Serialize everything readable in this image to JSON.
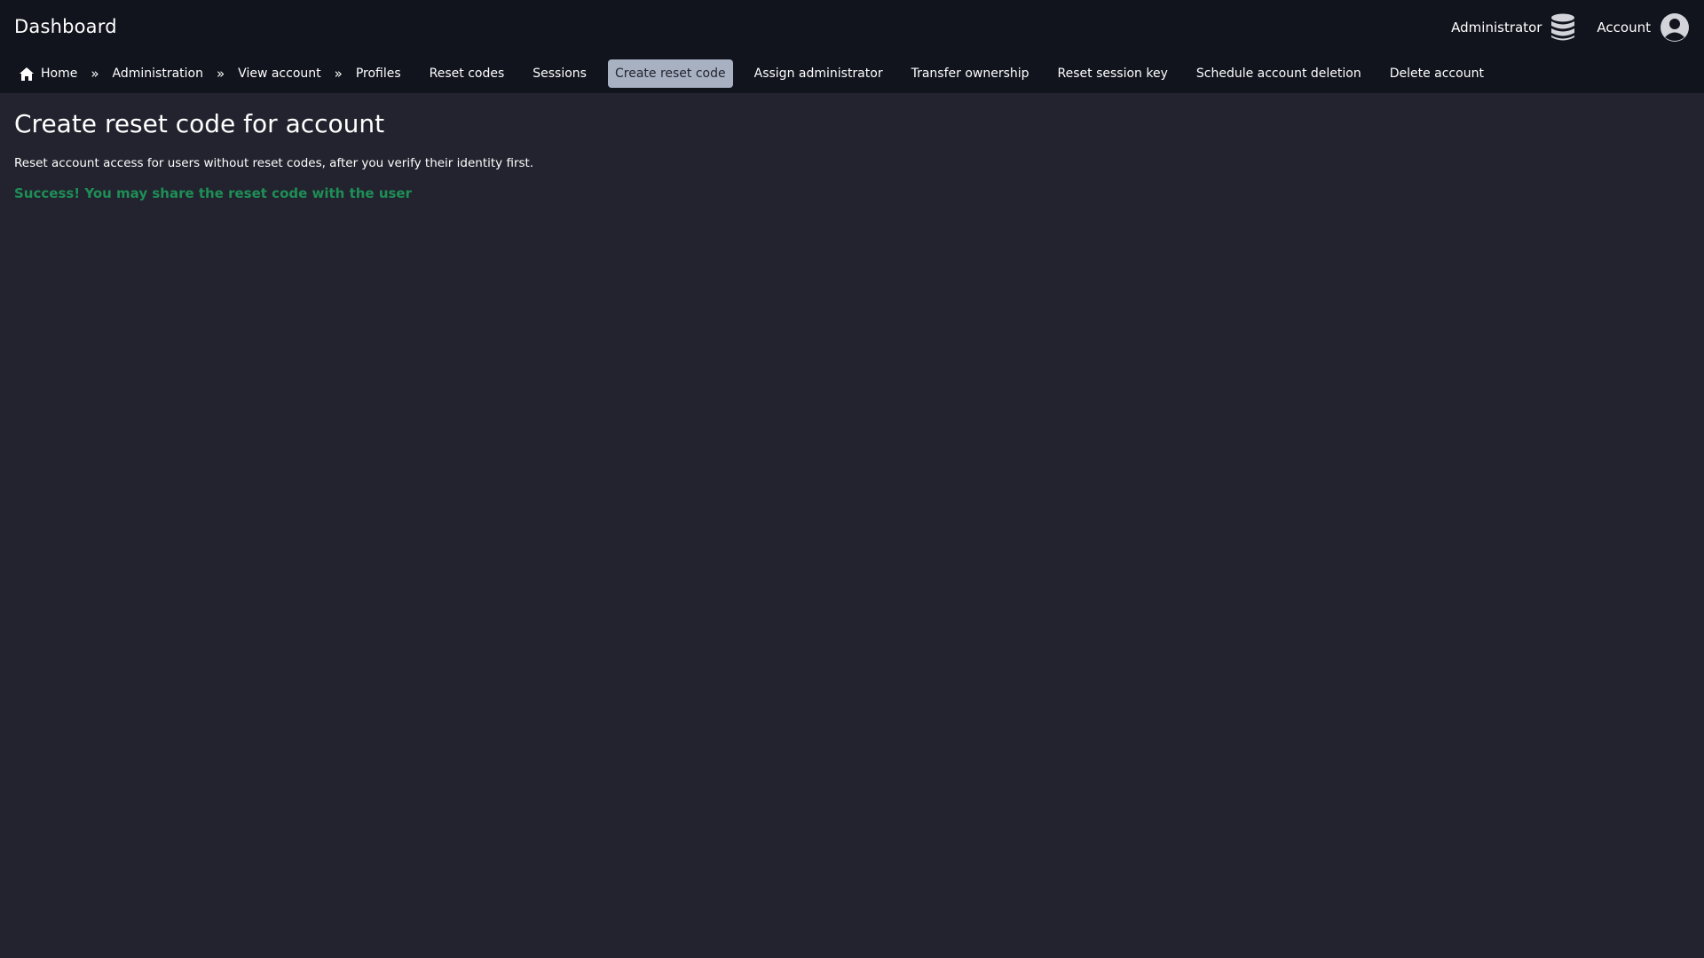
{
  "header": {
    "title": "Dashboard",
    "admin_label": "Administrator",
    "admin_icon": "database-icon",
    "account_label": "Account",
    "account_icon": "user-circle-icon"
  },
  "breadcrumbs": [
    {
      "label": "Home",
      "icon": "home-icon"
    },
    {
      "label": "Administration"
    },
    {
      "label": "View account"
    },
    {
      "label": "Profiles"
    }
  ],
  "breadcrumb_separator": "»",
  "actions": [
    {
      "label": "Reset codes",
      "active": false
    },
    {
      "label": "Sessions",
      "active": false
    },
    {
      "label": "Create reset code",
      "active": true
    },
    {
      "label": "Assign administrator",
      "active": false
    },
    {
      "label": "Transfer ownership",
      "active": false
    },
    {
      "label": "Reset session key",
      "active": false
    },
    {
      "label": "Schedule account deletion",
      "active": false
    },
    {
      "label": "Delete account",
      "active": false
    }
  ],
  "main": {
    "title": "Create reset code for account",
    "description": "Reset account access for users without reset codes, after you verify their identity first.",
    "success_message": "Success! You may share the reset code with the user"
  },
  "colors": {
    "background": "#22232e",
    "topbar": "#11131d",
    "active_tab": "#a8b1c2",
    "success": "#1e8e56"
  }
}
